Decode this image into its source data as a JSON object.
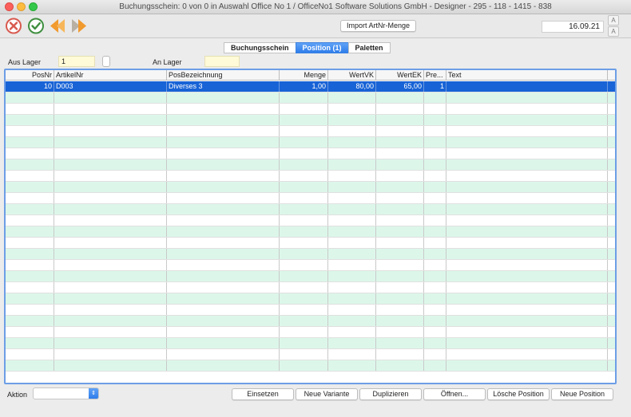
{
  "window": {
    "title": "Buchungsschein: 0 von 0 in Auswahl Office No 1 /  OfficeNo1 Software Solutions GmbH - Designer - 295 - 118 - 1415 - 838"
  },
  "toolbar": {
    "import_label": "Import ArtNr-Menge",
    "date": "16.09.21",
    "font_up_label": "A",
    "font_down_label": "A"
  },
  "tabs": [
    {
      "label": "Buchungsschein",
      "active": false
    },
    {
      "label": "Position (1)",
      "active": true
    },
    {
      "label": "Paletten",
      "active": false
    }
  ],
  "lager": {
    "aus_label": "Aus Lager",
    "aus_value": "1",
    "an_label": "An Lager",
    "an_value": ""
  },
  "table": {
    "columns": [
      "PosNr",
      "ArtikelNr",
      "PosBezeichnung",
      "Menge",
      "WertVK",
      "WertEK",
      "Pre...",
      "Text"
    ],
    "rows": [
      {
        "posnr": "10",
        "artikelnr": "D003",
        "bezeichnung": "Diverses 3",
        "menge": "1,00",
        "wertvk": "80,00",
        "wertek": "65,00",
        "pre": "1",
        "text": ""
      }
    ],
    "total_visible_rows": 26
  },
  "footer": {
    "aktion_label": "Aktion",
    "aktion_value": "",
    "buttons": [
      "Einsetzen",
      "Neue Variante",
      "Duplizieren",
      "Öffnen...",
      "Lösche Position",
      "Neue Position"
    ]
  },
  "colors": {
    "selection": "#1863d6",
    "stripe": "#dcf7ea",
    "accent": "#2f7deb",
    "field_yellow": "#fffad8"
  }
}
